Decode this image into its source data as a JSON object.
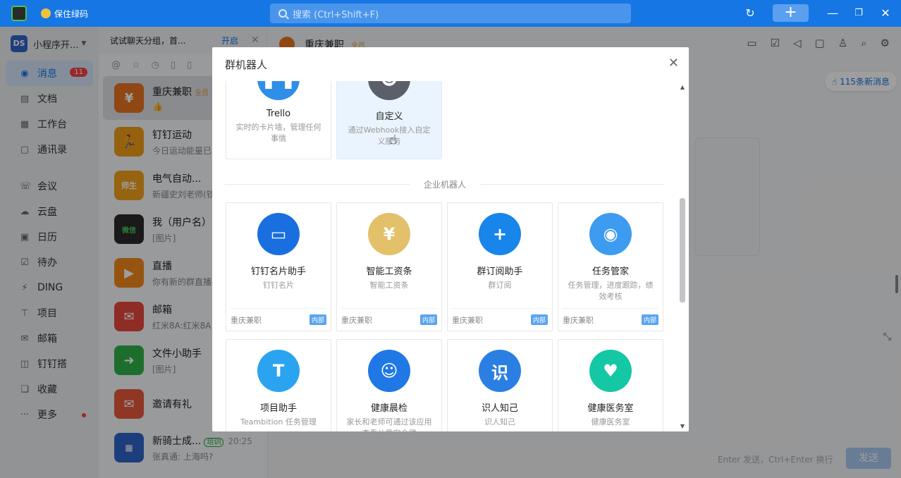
{
  "titlebar": {
    "app_label": "保住绿码",
    "search_placeholder": "搜索 (Ctrl+Shift+F)",
    "history_icon": "↻",
    "plus_icon": "+",
    "min_icon": "—",
    "max_icon": "❐",
    "close_icon": "✕"
  },
  "leftnav": {
    "org_logo": "DS",
    "org_name": "小程序开...",
    "items": [
      {
        "label": "消息",
        "icon": "◉",
        "badge": "11"
      },
      {
        "label": "文档",
        "icon": "▤"
      },
      {
        "label": "工作台",
        "icon": "▦"
      },
      {
        "label": "通讯录",
        "icon": "▢"
      },
      {
        "label": "会议",
        "icon": "☏"
      },
      {
        "label": "云盘",
        "icon": "☁"
      },
      {
        "label": "日历",
        "icon": "▣"
      },
      {
        "label": "待办",
        "icon": "☑"
      },
      {
        "label": "DING",
        "icon": "⚡"
      },
      {
        "label": "项目",
        "icon": "⊤"
      },
      {
        "label": "邮箱",
        "icon": "✉"
      },
      {
        "label": "钉钉搭",
        "icon": "◫"
      },
      {
        "label": "收藏",
        "icon": "❏"
      },
      {
        "label": "更多",
        "icon": "···"
      }
    ]
  },
  "convlist": {
    "tip": "试试聊天分组，首...",
    "tip_open": "开启",
    "tip_close": "✕",
    "filters": [
      "@",
      "☆",
      "◷",
      "▯",
      "▯"
    ],
    "items": [
      {
        "name": "重庆兼职",
        "tag": "全员",
        "preview": "👍",
        "avatar_text": "¥",
        "color": "#e8731f"
      },
      {
        "name": "钉钉运动",
        "preview": "今日运动能量已",
        "avatar_text": "🏃",
        "color": "#f29d19"
      },
      {
        "name": "电气自动...",
        "preview": "新疆史刘老师(钦",
        "avatar_text": "师生",
        "color": "#f3a21c"
      },
      {
        "name": "我（用户名）",
        "preview": "[图片]",
        "avatar_text": "微信",
        "color": "#2b2b2b"
      },
      {
        "name": "直播",
        "preview": "你有新的群直播",
        "avatar_text": "▶",
        "color": "#f08a1c"
      },
      {
        "name": "邮箱",
        "preview": "红米8A:红米8A",
        "avatar_text": "✉",
        "color": "#e5483d"
      },
      {
        "name": "文件小助手",
        "preview": "[图片]",
        "avatar_text": "➜",
        "color": "#2fb24a"
      },
      {
        "name": "邀请有礼",
        "preview": "",
        "avatar_text": "✉",
        "color": "#e9573b"
      },
      {
        "name": "新骑士成...",
        "tag": "培训",
        "time": "20:25",
        "preview": "张真通: 上海吗?",
        "avatar_text": "▦",
        "color": "#2f64c8"
      }
    ]
  },
  "chat": {
    "title": "重庆兼职",
    "tag": "全员",
    "header_icons": [
      "▭",
      "☑",
      "◁",
      "▢",
      "♙",
      "⌕",
      "⚙"
    ],
    "new_msg": "115条新消息",
    "send_hint": "Enter 发送，Ctrl+Enter 换行",
    "send_label": "发送",
    "expand_icon": "⤡"
  },
  "dialog": {
    "title": "群机器人",
    "close_icon": "✕",
    "section_label": "企业机器人",
    "top_cards": [
      {
        "name": "Trello",
        "desc": "实时的卡片墙，管理任何事情",
        "color": "#2f8ee8"
      },
      {
        "name": "自定义",
        "desc": "通过Webhook接入自定义服务",
        "color": "#5a5f6a"
      }
    ],
    "cards": [
      {
        "name": "钉钉名片助手",
        "desc": "钉钉名片",
        "owner": "重庆兼职",
        "badge": "内部",
        "color": "#1a6fe0",
        "glyph": "▭"
      },
      {
        "name": "智能工资条",
        "desc": "智能工资条",
        "owner": "重庆兼职",
        "badge": "内部",
        "color": "#e3c06a",
        "glyph": "¥"
      },
      {
        "name": "群订阅助手",
        "desc": "群订阅",
        "owner": "重庆兼职",
        "badge": "内部",
        "color": "#1785ea",
        "glyph": "+"
      },
      {
        "name": "任务管家",
        "desc": "任务管理，进度跟踪，绩效考核",
        "owner": "重庆兼职",
        "badge": "内部",
        "color": "#3d9bf0",
        "glyph": "◉"
      },
      {
        "name": "项目助手",
        "desc": "Teambition 任务管理",
        "color": "#2aa4f0",
        "glyph": "T"
      },
      {
        "name": "健康晨检",
        "desc": "家长和老师可通过该应用查看儿童安全健",
        "color": "#1f78e6",
        "glyph": "☺"
      },
      {
        "name": "识人知己",
        "desc": "识人知己",
        "color": "#2b7fe2",
        "glyph": "识"
      },
      {
        "name": "健康医务室",
        "desc": "健康医务室",
        "color": "#14c8a5",
        "glyph": "♥"
      }
    ]
  }
}
